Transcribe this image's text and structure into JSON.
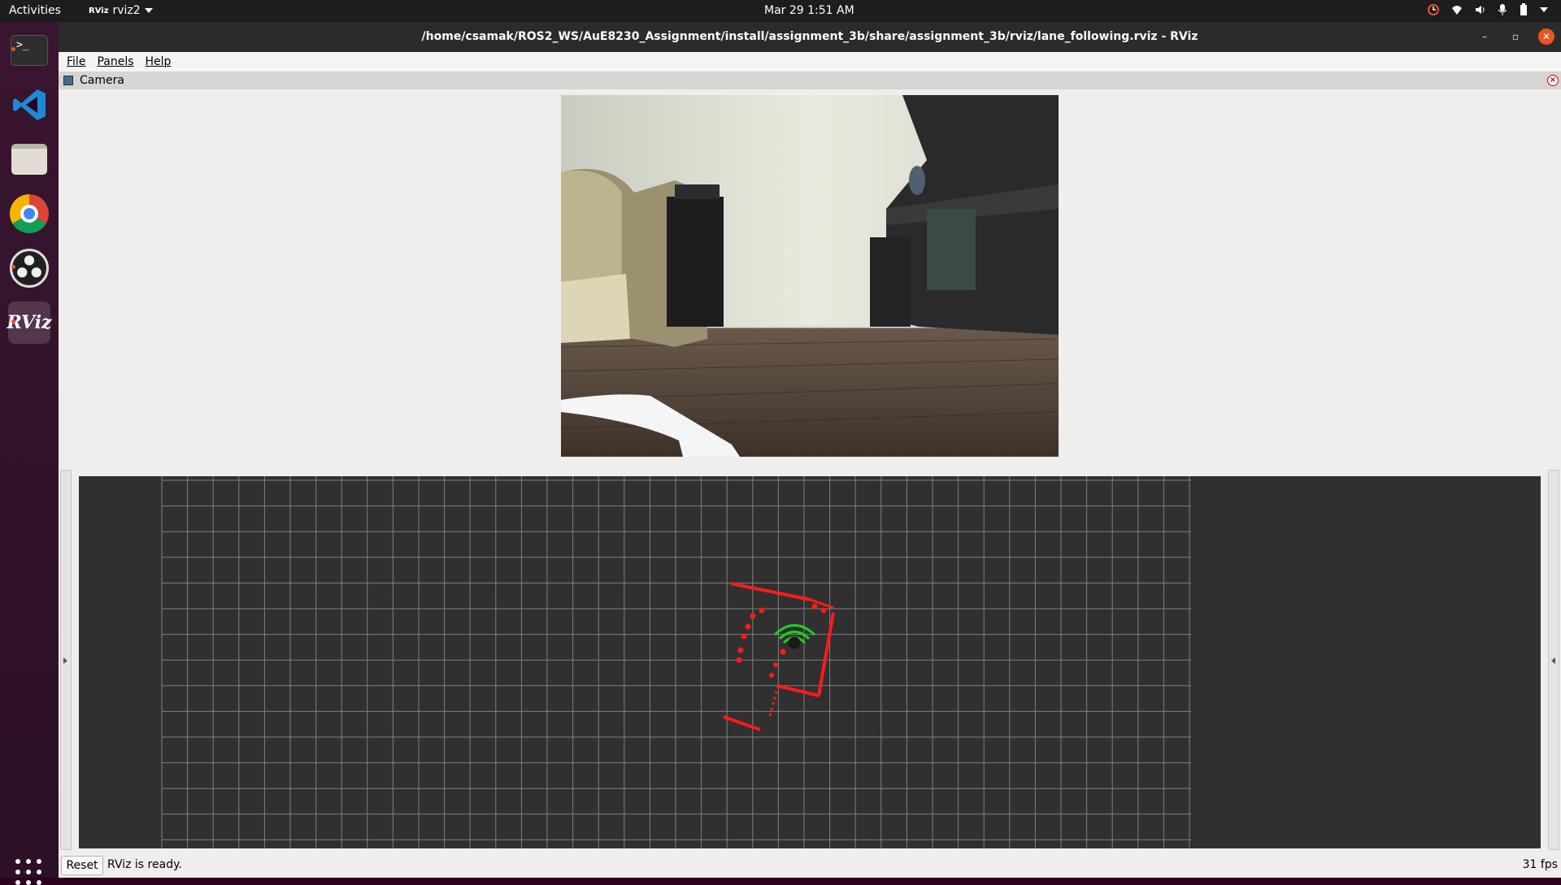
{
  "topbar": {
    "activities": "Activities",
    "app_name": "rviz2",
    "app_badge": "RViz",
    "clock": "Mar 29  1:51 AM",
    "tray_icons": [
      "update-icon",
      "wifi-icon",
      "volume-icon",
      "microphone-icon",
      "battery-icon",
      "system-menu-icon"
    ]
  },
  "dock": {
    "items": [
      {
        "name": "Terminal",
        "icon": "terminal-icon",
        "glyph": ">_"
      },
      {
        "name": "Visual Studio Code",
        "icon": "vscode-icon"
      },
      {
        "name": "Files",
        "icon": "folder-icon"
      },
      {
        "name": "Google Chrome",
        "icon": "chrome-icon"
      },
      {
        "name": "OBS Studio",
        "icon": "obs-icon"
      },
      {
        "name": "RViz",
        "icon": "rviz-icon",
        "glyph": "RViz",
        "active": true
      }
    ],
    "apps_grid": "show-applications-icon"
  },
  "window": {
    "title": "/home/csamak/ROS2_WS/AuE8230_Assignment/install/assignment_3b/share/assignment_3b/rviz/lane_following.rviz - RViz",
    "menu": [
      "File",
      "Panels",
      "Help"
    ],
    "camera_panel": {
      "title": "Camera"
    },
    "status": {
      "reset_label": "Reset",
      "message": "RViz is ready.",
      "fps": "31 fps"
    }
  },
  "colors": {
    "grid_bg": "#303030",
    "grid_line": "#a0a0a0",
    "laser": "#ff1a1a",
    "robot": "#22cc22",
    "accent": "#e95420"
  }
}
